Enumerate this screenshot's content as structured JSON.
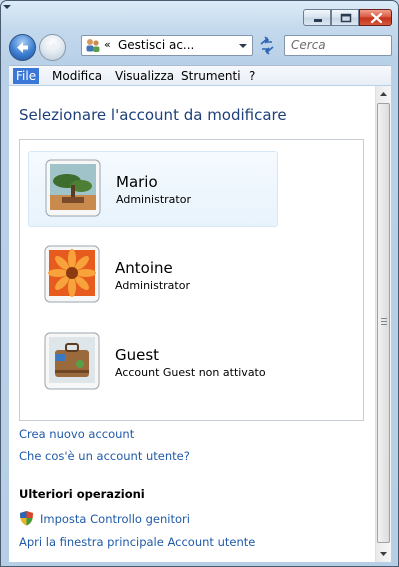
{
  "window": {
    "controls": {
      "minimize": "minimize-icon",
      "maximize": "maximize-icon",
      "close": "close-icon"
    }
  },
  "nav": {
    "address_chevron": "«",
    "address_text": "Gestisci ac...",
    "search_placeholder": "Cerca"
  },
  "menu": [
    "File",
    "Modifica",
    "Visualizza",
    "Strumenti",
    "?"
  ],
  "page": {
    "title": "Selezionare l'account da modificare",
    "accounts": [
      {
        "name": "Mario",
        "type": "Administrator"
      },
      {
        "name": "Antoine",
        "type": "Administrator"
      },
      {
        "name": "Guest",
        "type": "Account Guest non attivato"
      }
    ],
    "links": {
      "create": "Crea nuovo account",
      "what_is": "Che cos'è un account utente?"
    },
    "more": {
      "heading": "Ulteriori operazioni",
      "parental": "Imposta Controllo genitori",
      "main_window": "Apri la finestra principale Account utente"
    }
  },
  "colors": {
    "accent": "#1e3f7a",
    "link": "#1f5aa8",
    "menu_active": "#3a77d6"
  }
}
